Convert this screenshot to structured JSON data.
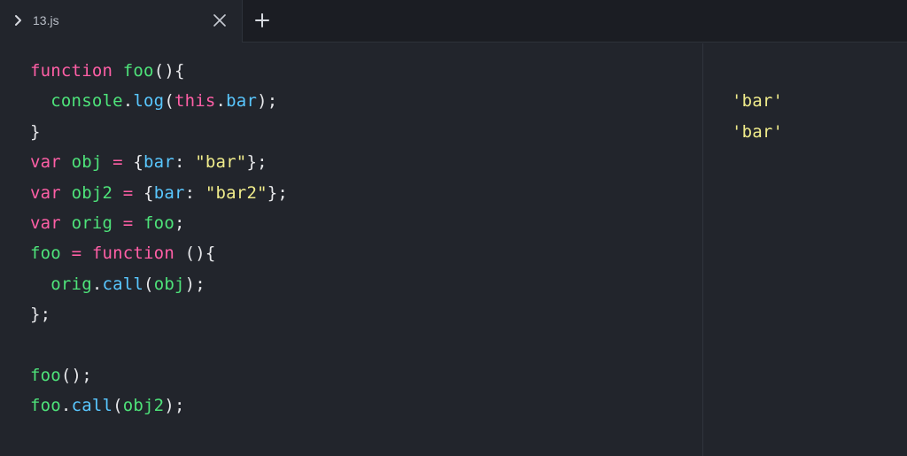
{
  "tab": {
    "title": "13.js"
  },
  "colors": {
    "background": "#22252c",
    "tabbar": "#1b1d23",
    "keyword": "#ff5fa6",
    "function": "#4ee37a",
    "property": "#59c7ff",
    "string": "#f0ec8b",
    "punctuation": "#e6e7ea"
  },
  "icons": {
    "tab_chevron": "chevron-right-icon",
    "tab_close": "close-icon",
    "new_tab": "plus-icon"
  },
  "code": [
    [
      {
        "t": "function",
        "c": "kw"
      },
      {
        "t": " ",
        "c": "pun"
      },
      {
        "t": "foo",
        "c": "fn"
      },
      {
        "t": "(){",
        "c": "pun"
      }
    ],
    [
      {
        "t": "  ",
        "c": "pun"
      },
      {
        "t": "console",
        "c": "var"
      },
      {
        "t": ".",
        "c": "pun"
      },
      {
        "t": "log",
        "c": "prop"
      },
      {
        "t": "(",
        "c": "pun"
      },
      {
        "t": "this",
        "c": "ths"
      },
      {
        "t": ".",
        "c": "pun"
      },
      {
        "t": "bar",
        "c": "prop"
      },
      {
        "t": ");",
        "c": "pun"
      }
    ],
    [
      {
        "t": "}",
        "c": "pun"
      }
    ],
    [
      {
        "t": "var",
        "c": "kw"
      },
      {
        "t": " ",
        "c": "pun"
      },
      {
        "t": "obj",
        "c": "var"
      },
      {
        "t": " ",
        "c": "pun"
      },
      {
        "t": "=",
        "c": "kw"
      },
      {
        "t": " {",
        "c": "pun"
      },
      {
        "t": "bar",
        "c": "prop"
      },
      {
        "t": ": ",
        "c": "pun"
      },
      {
        "t": "\"bar\"",
        "c": "str"
      },
      {
        "t": "};",
        "c": "pun"
      }
    ],
    [
      {
        "t": "var",
        "c": "kw"
      },
      {
        "t": " ",
        "c": "pun"
      },
      {
        "t": "obj2",
        "c": "var"
      },
      {
        "t": " ",
        "c": "pun"
      },
      {
        "t": "=",
        "c": "kw"
      },
      {
        "t": " {",
        "c": "pun"
      },
      {
        "t": "bar",
        "c": "prop"
      },
      {
        "t": ": ",
        "c": "pun"
      },
      {
        "t": "\"bar2\"",
        "c": "str"
      },
      {
        "t": "};",
        "c": "pun"
      }
    ],
    [
      {
        "t": "var",
        "c": "kw"
      },
      {
        "t": " ",
        "c": "pun"
      },
      {
        "t": "orig",
        "c": "var"
      },
      {
        "t": " ",
        "c": "pun"
      },
      {
        "t": "=",
        "c": "kw"
      },
      {
        "t": " ",
        "c": "pun"
      },
      {
        "t": "foo",
        "c": "var"
      },
      {
        "t": ";",
        "c": "pun"
      }
    ],
    [
      {
        "t": "foo",
        "c": "var"
      },
      {
        "t": " ",
        "c": "pun"
      },
      {
        "t": "=",
        "c": "kw"
      },
      {
        "t": " ",
        "c": "pun"
      },
      {
        "t": "function",
        "c": "kw"
      },
      {
        "t": " (){",
        "c": "pun"
      }
    ],
    [
      {
        "t": "  ",
        "c": "pun"
      },
      {
        "t": "orig",
        "c": "var"
      },
      {
        "t": ".",
        "c": "pun"
      },
      {
        "t": "call",
        "c": "prop"
      },
      {
        "t": "(",
        "c": "pun"
      },
      {
        "t": "obj",
        "c": "var"
      },
      {
        "t": ");",
        "c": "pun"
      }
    ],
    [
      {
        "t": "};",
        "c": "pun"
      }
    ],
    [],
    [
      {
        "t": "foo",
        "c": "var"
      },
      {
        "t": "();",
        "c": "pun"
      }
    ],
    [
      {
        "t": "foo",
        "c": "var"
      },
      {
        "t": ".",
        "c": "pun"
      },
      {
        "t": "call",
        "c": "prop"
      },
      {
        "t": "(",
        "c": "pun"
      },
      {
        "t": "obj2",
        "c": "var"
      },
      {
        "t": ");",
        "c": "pun"
      }
    ]
  ],
  "output": [
    "",
    "'bar'",
    "'bar'"
  ]
}
